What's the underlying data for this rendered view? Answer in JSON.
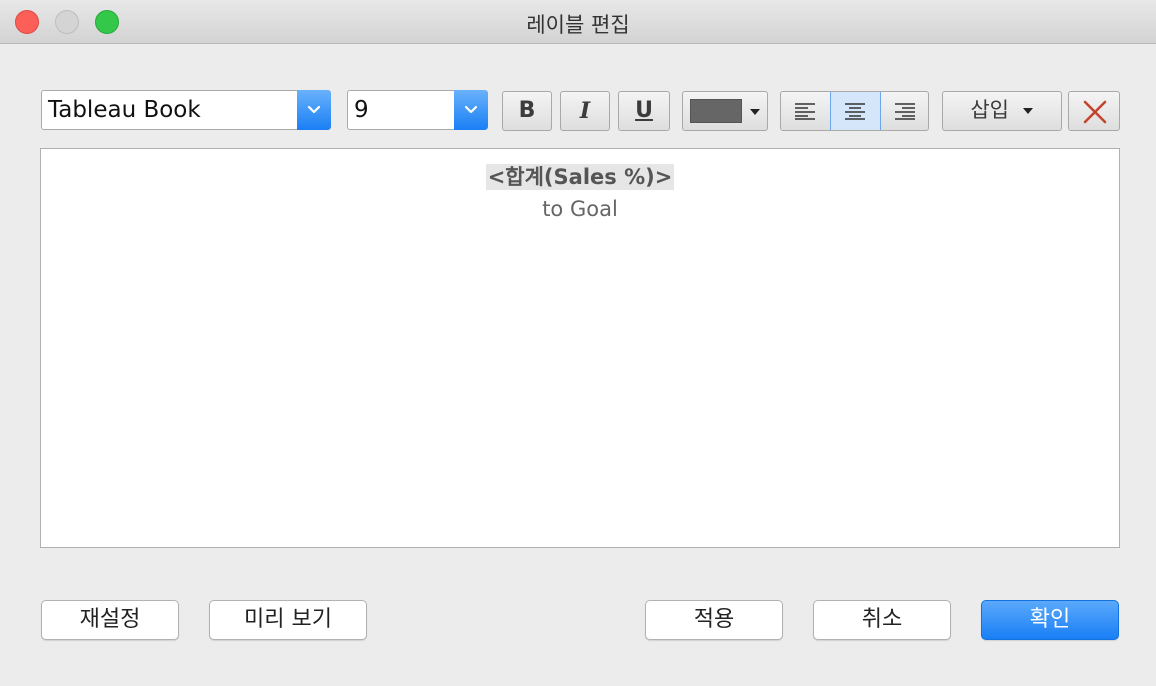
{
  "window": {
    "title": "레이블 편집"
  },
  "toolbar": {
    "font_value": "Tableau Book",
    "size_value": "9",
    "bold_label": "B",
    "italic_label": "I",
    "underline_label": "U",
    "text_color": "#666666",
    "align_active": "center",
    "insert_label": "삽입"
  },
  "editor": {
    "line1": "<합계(Sales %)>",
    "line2": "to Goal"
  },
  "buttons": {
    "reset": "재설정",
    "preview": "미리 보기",
    "apply": "적용",
    "cancel": "취소",
    "ok": "확인"
  },
  "colors": {
    "accent": "#1a7ff5"
  }
}
